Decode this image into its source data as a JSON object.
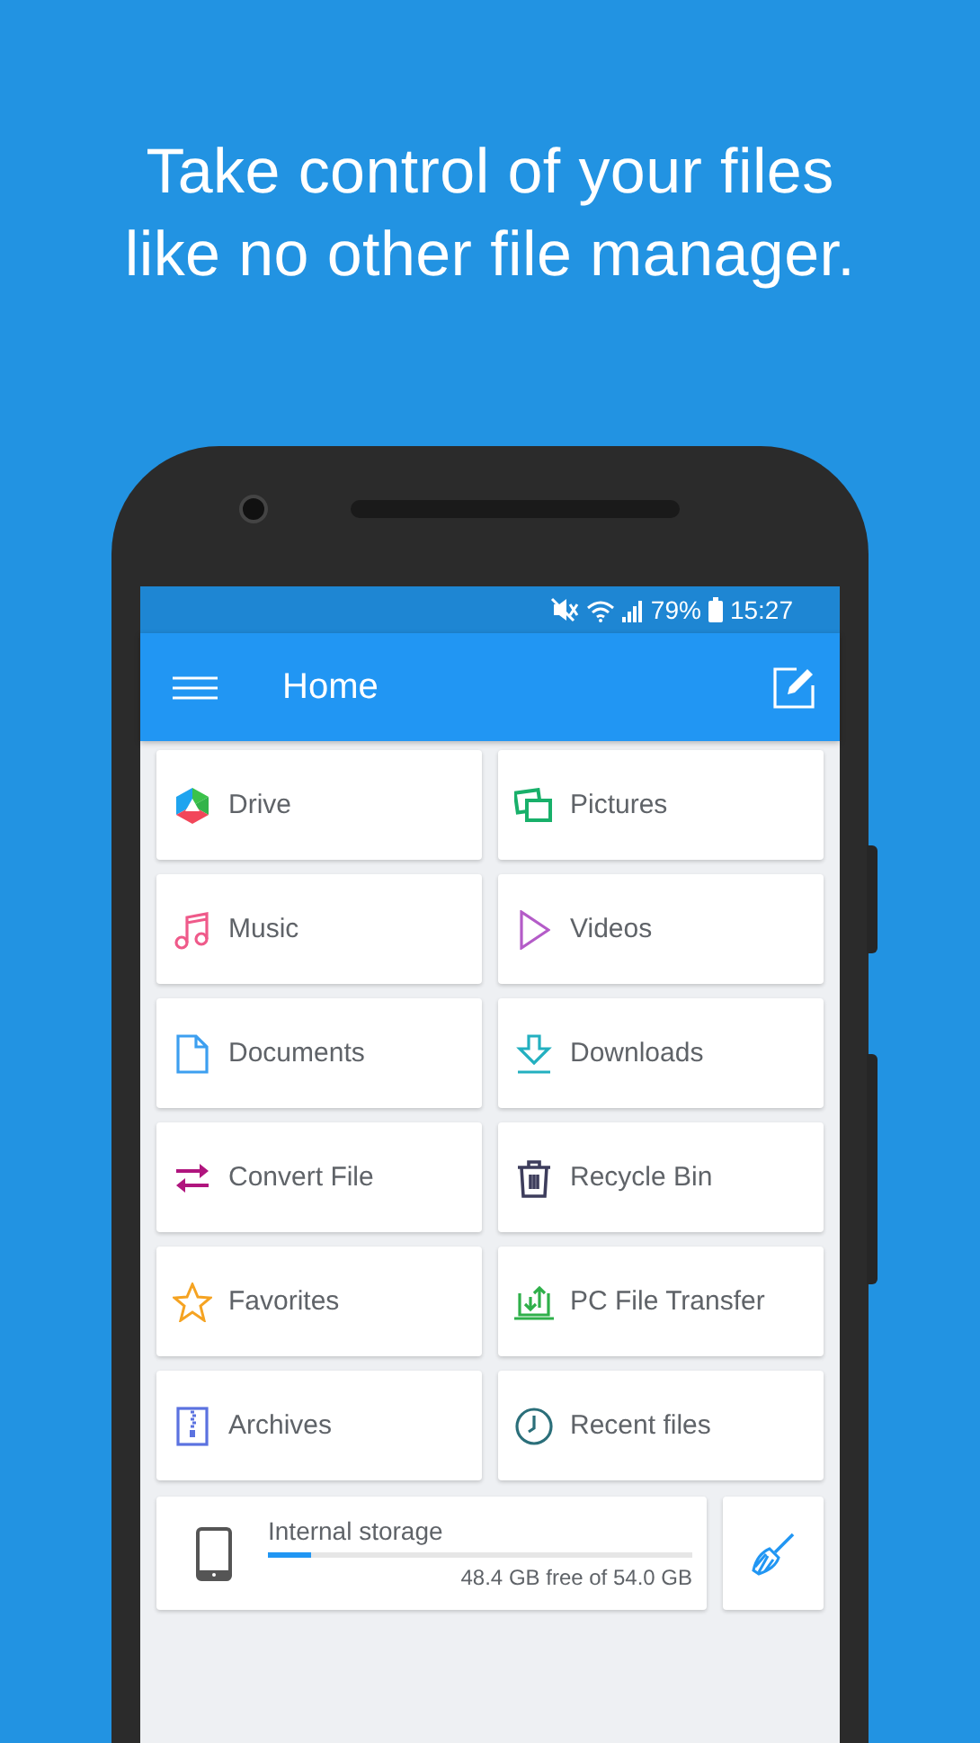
{
  "headline": [
    "Take control of your files",
    "like no other file manager."
  ],
  "status_bar": {
    "battery": "79%",
    "time": "15:27"
  },
  "app_bar": {
    "title": "Home"
  },
  "tiles": [
    {
      "label": "Drive"
    },
    {
      "label": "Pictures"
    },
    {
      "label": "Music"
    },
    {
      "label": "Videos"
    },
    {
      "label": "Documents"
    },
    {
      "label": "Downloads"
    },
    {
      "label": "Convert File"
    },
    {
      "label": "Recycle Bin"
    },
    {
      "label": "Favorites"
    },
    {
      "label": "PC File Transfer"
    },
    {
      "label": "Archives"
    },
    {
      "label": "Recent files"
    }
  ],
  "storage": {
    "name": "Internal storage",
    "level": 0.1,
    "reading": "48.4 GB free of 54.0 GB"
  }
}
